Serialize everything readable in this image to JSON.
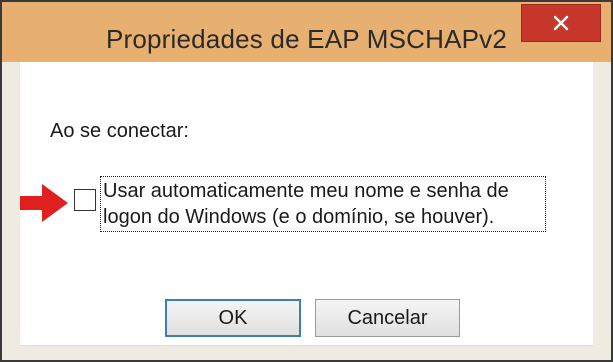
{
  "window": {
    "title": "Propriedades de EAP MSCHAPv2",
    "close_icon": "close-icon"
  },
  "content": {
    "connect_label": "Ao se conectar:",
    "checkbox": {
      "checked": false,
      "label_line1": "Usar automaticamente meu nome e senha de",
      "label_line2": "logon do Windows (e o domínio, se houver)."
    },
    "annotation_icon": "red-arrow-icon"
  },
  "buttons": {
    "ok_label": "OK",
    "cancel_label": "Cancelar"
  },
  "colors": {
    "titlebar": "#e8b070",
    "close": "#c7372c",
    "annotation_arrow": "#e02020",
    "default_button_border": "#3c7fb1"
  }
}
